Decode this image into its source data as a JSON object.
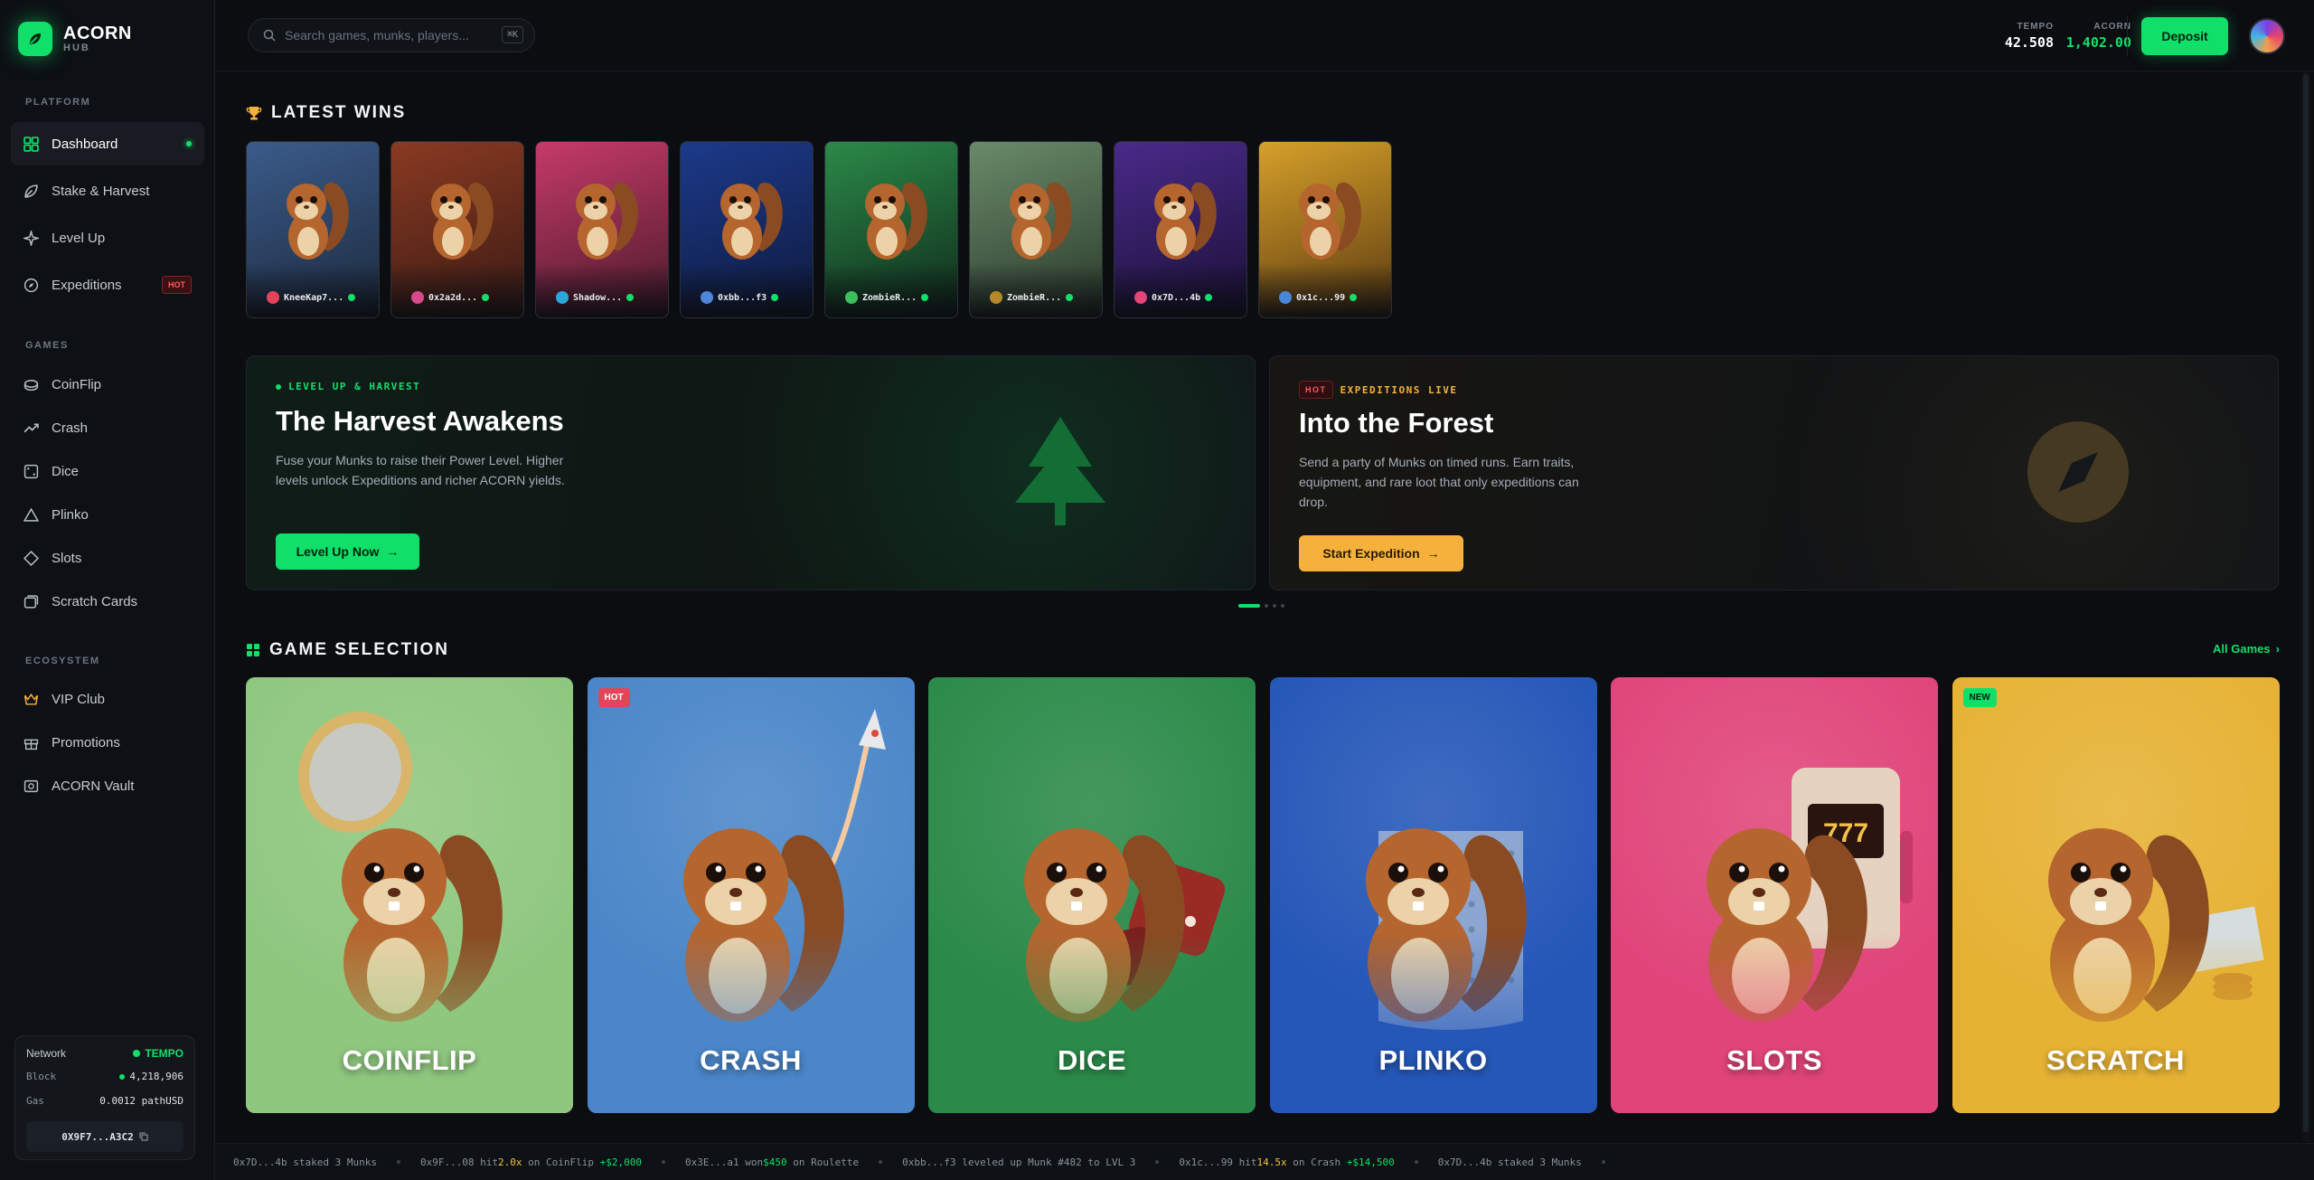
{
  "brand": {
    "name": "ACORN",
    "sub": "HUB"
  },
  "sidebar": {
    "sections": {
      "platform": "PLATFORM",
      "games": "GAMES",
      "ecosystem": "ECOSYSTEM"
    },
    "platform": [
      {
        "label": "Dashboard"
      },
      {
        "label": "Stake & Harvest"
      },
      {
        "label": "Level Up"
      },
      {
        "label": "Expeditions",
        "badge": "HOT"
      }
    ],
    "games": [
      {
        "label": "CoinFlip"
      },
      {
        "label": "Crash"
      },
      {
        "label": "Dice"
      },
      {
        "label": "Plinko"
      },
      {
        "label": "Slots"
      },
      {
        "label": "Scratch Cards"
      }
    ],
    "ecosystem": [
      {
        "label": "VIP Club"
      },
      {
        "label": "Promotions"
      },
      {
        "label": "ACORN Vault"
      }
    ],
    "network": {
      "label": "Network",
      "value": "TEMPO",
      "block_label": "Block",
      "block_value": "4,218,906",
      "gas_label": "Gas",
      "gas_value": "0.0012 pathUSD",
      "wallet": "0X9F7...A3C2"
    }
  },
  "header": {
    "search_placeholder": "Search games, munks, players...",
    "search_shortcut": "⌘K",
    "balances": [
      {
        "label": "TEMPO",
        "value": "42.508"
      },
      {
        "label": "ACORN",
        "value": "1,402.00"
      }
    ],
    "deposit": "Deposit"
  },
  "latest_wins": {
    "title": "LATEST WINS",
    "items": [
      {
        "user": "KneeKap7...",
        "color": "#e2455b"
      },
      {
        "user": "0x2a2d...",
        "color": "#d64a8b"
      },
      {
        "user": "Shadow...",
        "color": "#2aa7d8"
      },
      {
        "user": "0xbb...f3",
        "color": "#4f86d8"
      },
      {
        "user": "ZombieR...",
        "color": "#3cbf5e"
      },
      {
        "user": "ZombieR...",
        "color": "#b38a2a"
      },
      {
        "user": "0x7D...4b",
        "color": "#e2457a"
      },
      {
        "user": "0x1c...99",
        "color": "#4a86d8"
      }
    ]
  },
  "promos": [
    {
      "kicker": "LEVEL UP & HARVEST",
      "title": "The Harvest Awakens",
      "desc": "Fuse your Munks to raise their Power Level. Higher levels unlock Expeditions and richer ACORN yields.",
      "cta": "Level Up Now",
      "accent": "#10e06a"
    },
    {
      "badge": "HOT",
      "kicker": "EXPEDITIONS LIVE",
      "title": "Into the Forest",
      "desc": "Send a party of Munks on timed runs. Earn traits, equipment, and rare loot that only expeditions can drop.",
      "cta": "Start Expedition",
      "accent": "#f6b13c"
    }
  ],
  "game_selection": {
    "title": "GAME SELECTION",
    "all_link": "All Games",
    "games": [
      {
        "name": "COINFLIP",
        "bg": "#8fc77f"
      },
      {
        "name": "CRASH",
        "bg": "#4a86c8",
        "badge": "HOT"
      },
      {
        "name": "DICE",
        "bg": "#2b8a49"
      },
      {
        "name": "PLINKO",
        "bg": "#2557b8"
      },
      {
        "name": "SLOTS",
        "bg": "#e0457a"
      },
      {
        "name": "SCRATCH",
        "bg": "#e6b234",
        "badge": "NEW"
      }
    ]
  },
  "ticker": [
    {
      "pre": "0x7D...4b staked 3 Munks"
    },
    {
      "pre": "0x9F...08 hit ",
      "mult": "2.0x",
      "mid": " on CoinFlip ",
      "amt": "+$2,000"
    },
    {
      "pre": "0x3E...a1 won ",
      "amt2": "$450",
      "mid": " on Roulette"
    },
    {
      "pre": "0xbb...f3 leveled up Munk #482 to LVL 3"
    },
    {
      "pre": "0x1c...99 hit ",
      "mult": "14.5x",
      "mid": " on Crash ",
      "amt": "+$14,500"
    },
    {
      "pre": "0x7D...4b staked 3 Munks"
    }
  ]
}
